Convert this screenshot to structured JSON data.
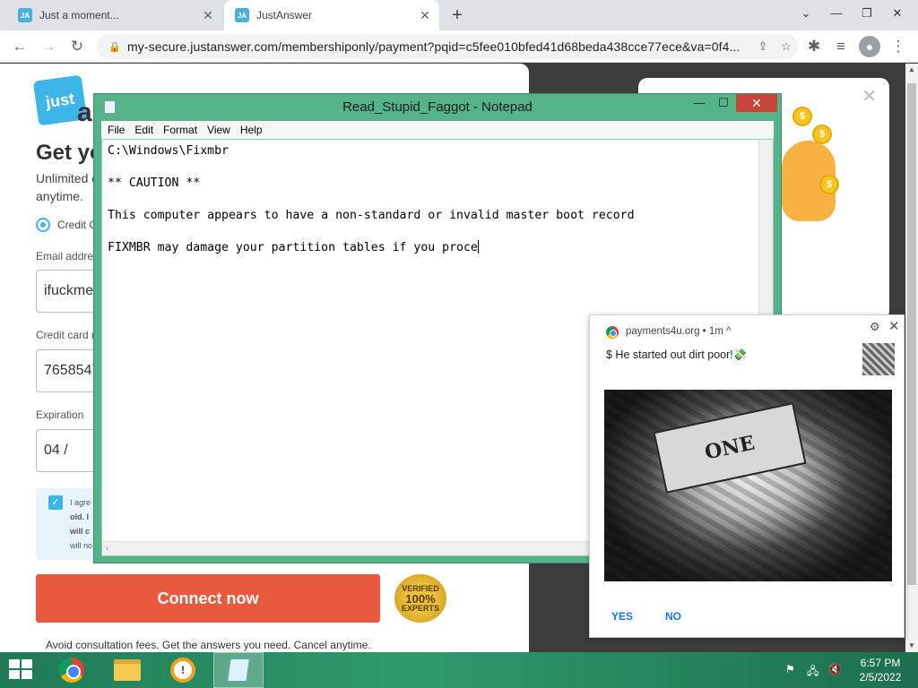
{
  "browser": {
    "tabs": [
      {
        "label": "Just a moment..."
      },
      {
        "label": "JustAnswer"
      }
    ],
    "url": "my-secure.justanswer.com/membershiponly/payment?pqid=c5fee010bfed41d68beda438cce77ece&va=0f4..."
  },
  "page": {
    "logo_text": "just",
    "logo_suffix": "a",
    "headline": "Get yo",
    "subline": "Unlimited c",
    "subline2": "anytime.",
    "payment_option": "Credit C",
    "email_label": "Email addre",
    "email_value": "ifuckme",
    "card_label": "Credit card n",
    "card_value": "7658547",
    "expiration_label": "Expiration",
    "expiration_value": "04 /",
    "consent_lines": [
      "I agre",
      "old. I",
      "will c",
      "will no"
    ],
    "connect_button": "Connect now",
    "badge_top": "VERIFIED",
    "badge_mid": "100%",
    "badge_bottom": "EXPERTS",
    "footer_note": "Avoid consultation fees. Get the answers you need. Cancel anytime.",
    "promo_close": "✕",
    "promo_coins": [
      "$",
      "$",
      "$"
    ]
  },
  "notepad": {
    "title": "Read_Stupid_Faggot - Notepad",
    "menu": [
      "File",
      "Edit",
      "Format",
      "View",
      "Help"
    ],
    "lines": [
      "C:\\Windows\\Fixmbr",
      "",
      "** CAUTION **",
      "",
      "This computer appears to have a non-standard or invalid master boot record",
      "",
      "FIXMBR may damage your partition tables if you proce"
    ]
  },
  "notification": {
    "origin": "payments4u.org",
    "age": "• 1m ^",
    "message": "$ He started out dirt poor!💸",
    "image_text": "ONE",
    "yes": "YES",
    "no": "NO"
  },
  "taskbar": {
    "time": "6:57 PM",
    "date": "2/5/2022"
  },
  "colors": {
    "notepad_frame": "#55b389",
    "taskbar": "#2f9a6c",
    "connect_button": "#e8593e",
    "brand": "#3db5e6"
  }
}
